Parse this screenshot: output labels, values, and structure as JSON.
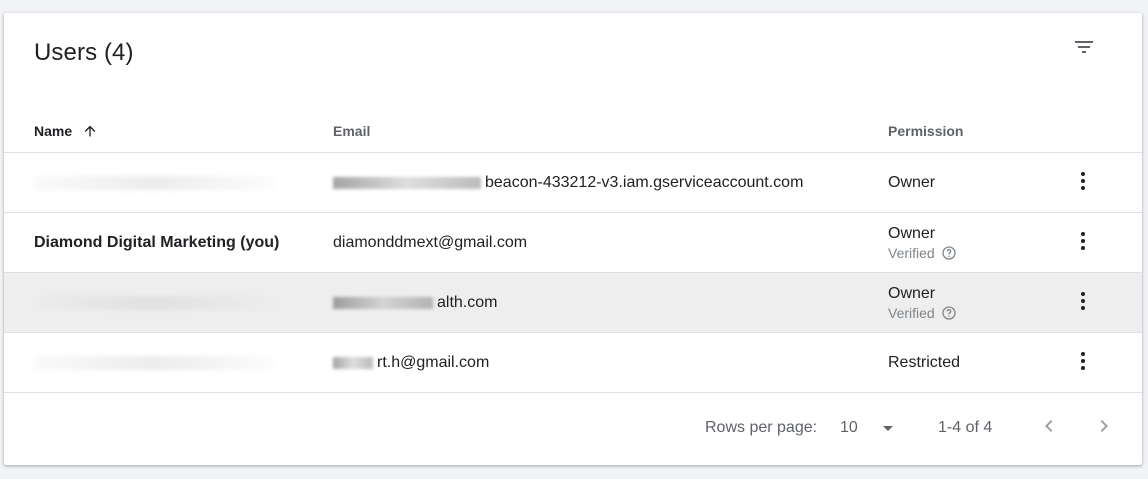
{
  "card": {
    "title": "Users (4)"
  },
  "icons": {
    "filter": "filter-list-icon",
    "sort": "arrow-upward-icon",
    "more": "more-vert-icon",
    "help": "help-outline-icon",
    "dropdown": "arrow-drop-down-icon",
    "prev": "chevron-left-icon",
    "next": "chevron-right-icon"
  },
  "table": {
    "columns": {
      "name": "Name",
      "email": "Email",
      "permission": "Permission"
    },
    "rows": [
      {
        "name": "",
        "name_redacted": true,
        "email_visible": "beacon-433212-v3.iam.gserviceaccount.com",
        "email_prefix_redacted": true,
        "permission": "Owner",
        "status": ""
      },
      {
        "name": "Diamond Digital Marketing (you)",
        "name_redacted": false,
        "email_visible": "diamonddmext@gmail.com",
        "email_prefix_redacted": false,
        "permission": "Owner",
        "status": "Verified"
      },
      {
        "name": "",
        "name_redacted": true,
        "email_visible": "alth.com",
        "email_prefix_redacted": true,
        "permission": "Owner",
        "status": "Verified"
      },
      {
        "name": "",
        "name_redacted": true,
        "email_visible": "rt.h@gmail.com",
        "email_prefix_redacted": true,
        "permission": "Restricted",
        "status": ""
      }
    ]
  },
  "footer": {
    "rows_per_page_label": "Rows per page:",
    "rows_per_page_value": "10",
    "range": "1-4 of 4"
  },
  "colors": {
    "background": "#f1f3f6",
    "card": "#ffffff",
    "highlight_row": "#eeeeee",
    "secondary_text": "#5f6368",
    "muted_text": "#80868b"
  }
}
